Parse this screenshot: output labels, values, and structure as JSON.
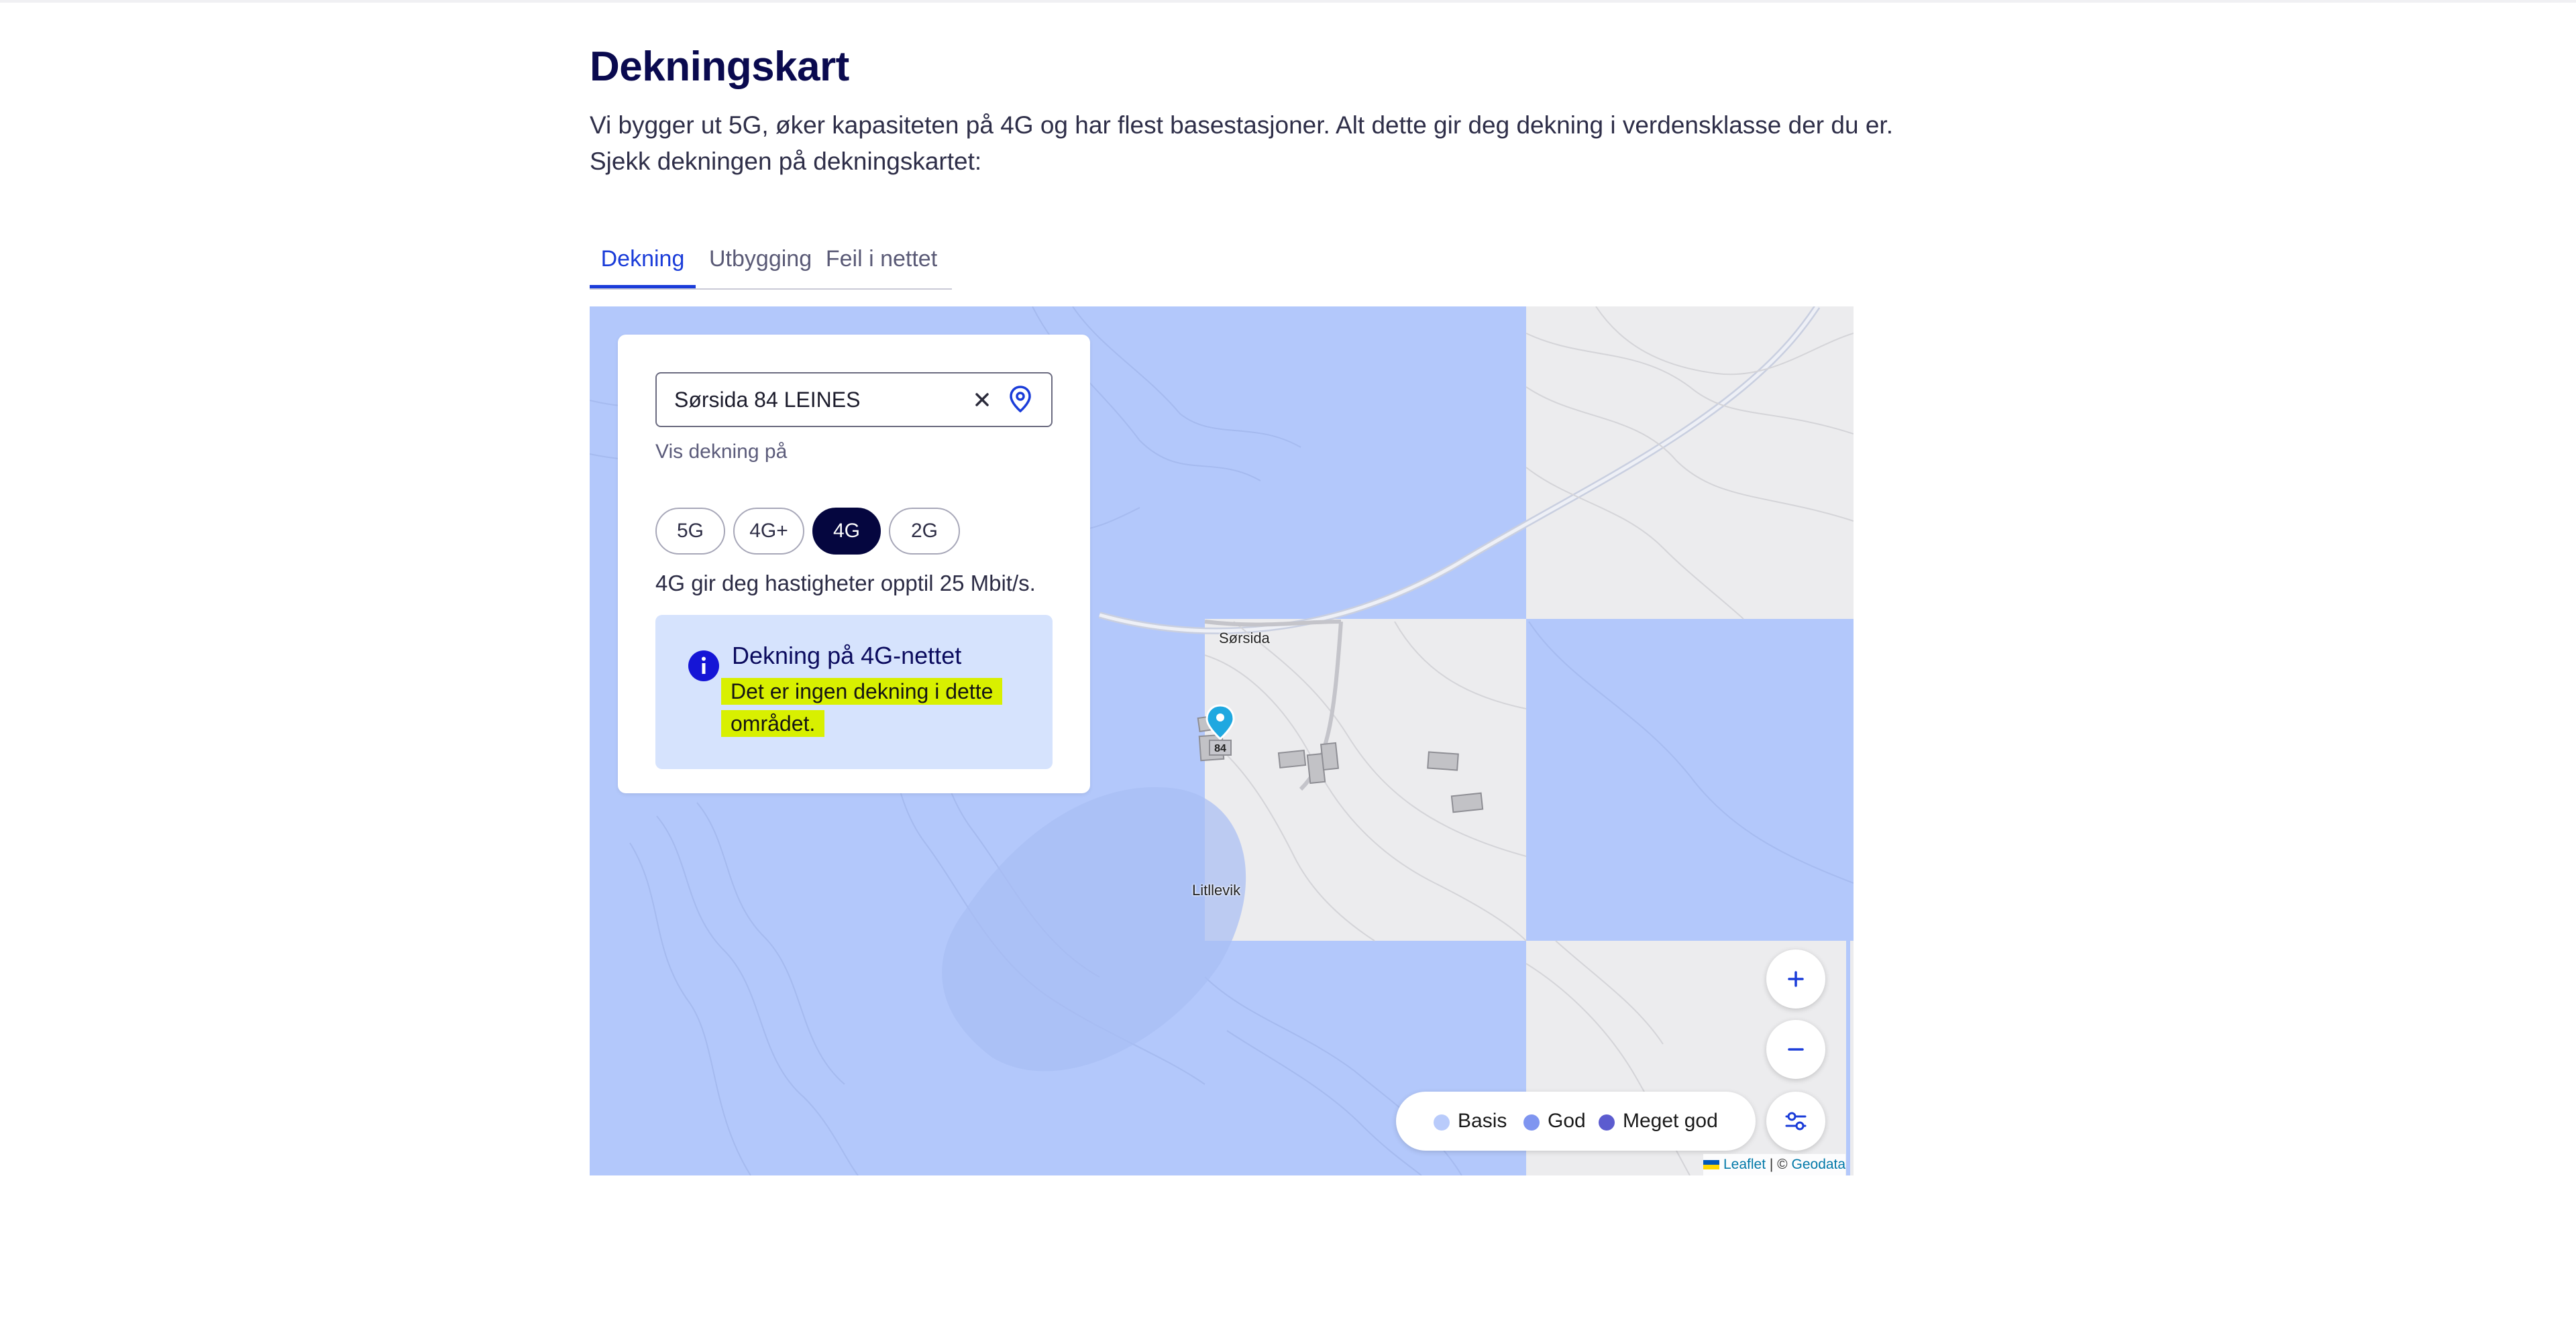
{
  "page": {
    "title": "Dekningskart",
    "intro": "Vi bygger ut 5G, øker kapasiteten på 4G og har flest basestasjoner. Alt dette gir deg dekning i verdensklasse der du er. Sjekk dekningen på dekningskartet:"
  },
  "tabs": [
    {
      "label": "Dekning",
      "active": true
    },
    {
      "label": "Utbygging",
      "active": false
    },
    {
      "label": "Feil i nettet",
      "active": false
    }
  ],
  "panel": {
    "search_value": "Sørsida 84 LEINES",
    "clear_icon": "close-icon",
    "locate_icon": "location-pin-icon",
    "vis_label": "Vis dekning på",
    "chips": [
      "5G",
      "4G+",
      "4G",
      "2G"
    ],
    "selected_chip": "4G",
    "speed_text": "4G gir deg hastigheter opptil 25 Mbit/s.",
    "info": {
      "icon": "info-icon",
      "title": "Dekning på 4G-nettet",
      "message": "Det er ingen dekning i dette området."
    }
  },
  "map": {
    "places": [
      "Sørsida",
      "Litllevik"
    ],
    "address_number": "84",
    "legend": [
      {
        "label": "Basis",
        "color": "#b9cbfb"
      },
      {
        "label": "God",
        "color": "#7f95f0"
      },
      {
        "label": "Meget god",
        "color": "#5c5ccf"
      }
    ],
    "attribution": {
      "leaflet": "Leaflet",
      "separator": " | © ",
      "geodata": "Geodata"
    }
  },
  "colors": {
    "accent": "#1a3cd9",
    "dark_navy": "#05063f",
    "coverage": "#b3c8fb",
    "info_bg": "#d6e3fd",
    "highlight": "#d8f000"
  }
}
